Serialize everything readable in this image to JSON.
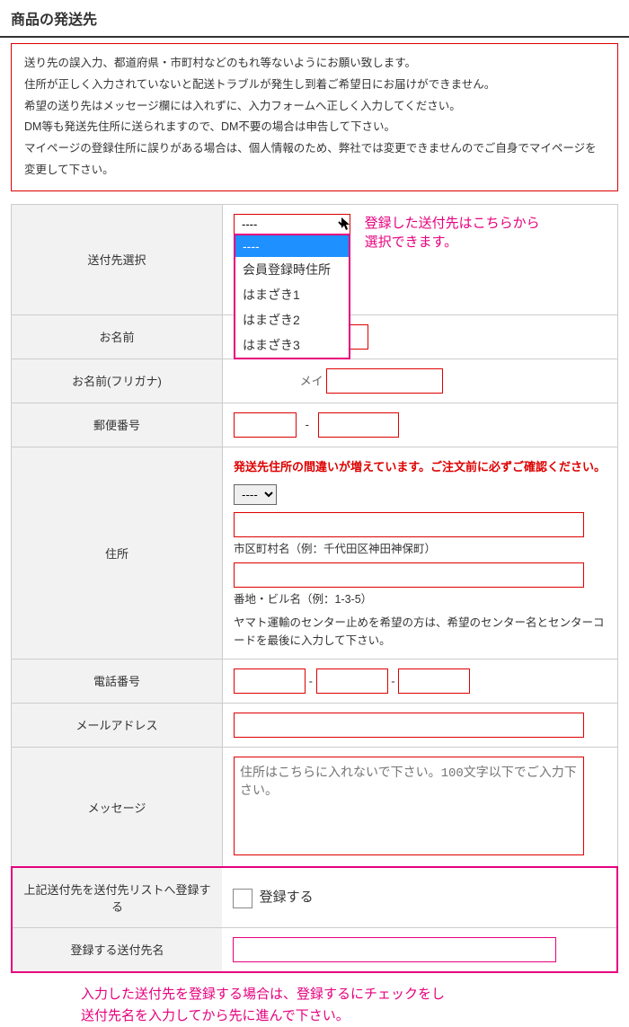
{
  "title": "商品の発送先",
  "notices": {
    "l1": "送り先の誤入力、都道府県・市町村などのもれ等ないようにお願い致します。",
    "l2": "住所が正しく入力されていないと配送トラブルが発生し到着ご希望日にお届けができません。",
    "l3": "希望の送り先はメッセージ欄には入れずに、入力フォームへ正しく入力してください。",
    "l4": "DM等も発送先住所に送られますので、DM不要の場合は申告して下さい。",
    "l5": "マイページの登録住所に誤りがある場合は、個人情報のため、弊社では変更できませんのでご自身でマイページを変更して下さい。"
  },
  "labels": {
    "dest_select": "送付先選択",
    "name": "お名前",
    "name_kana": "お名前(フリガナ)",
    "zip": "郵便番号",
    "address": "住所",
    "phone": "電話番号",
    "email": "メールアドレス",
    "message": "メッセージ",
    "register_to_list": "上記送付先を送付先リストへ登録する",
    "register_name": "登録する送付先名"
  },
  "dest": {
    "selected": "----",
    "options": {
      "blank": "----",
      "member": "会員登録時住所",
      "h1": "はまざき1",
      "h2": "はまざき2",
      "h3": "はまざき3"
    },
    "callout1": "登録した送付先はこちらから",
    "callout2": "選択できます。"
  },
  "kana_mei": "メイ",
  "zip_dash": "-",
  "addr": {
    "warn": "発送先住所の間違いが増えています。ご注文前に必ずご確認ください。",
    "pref_blank": "----",
    "city_label": "市区町村名（例：千代田区神田神保町）",
    "block_label": "番地・ビル名（例：1-3-5）",
    "help": "ヤマト運輸のセンター止めを希望の方は、希望のセンター名とセンターコードを最後に入力して下さい。"
  },
  "phone_dash": "-",
  "msg_placeholder": "住所はこちらに入れないで下さい。100文字以下でご入力下さい。",
  "register_checkbox_label": "登録する",
  "bottom_note": {
    "l1": "入力した送付先を登録する場合は、登録するにチェックをし",
    "l2": "送付先名を入力してから先に進んで下さい。"
  }
}
